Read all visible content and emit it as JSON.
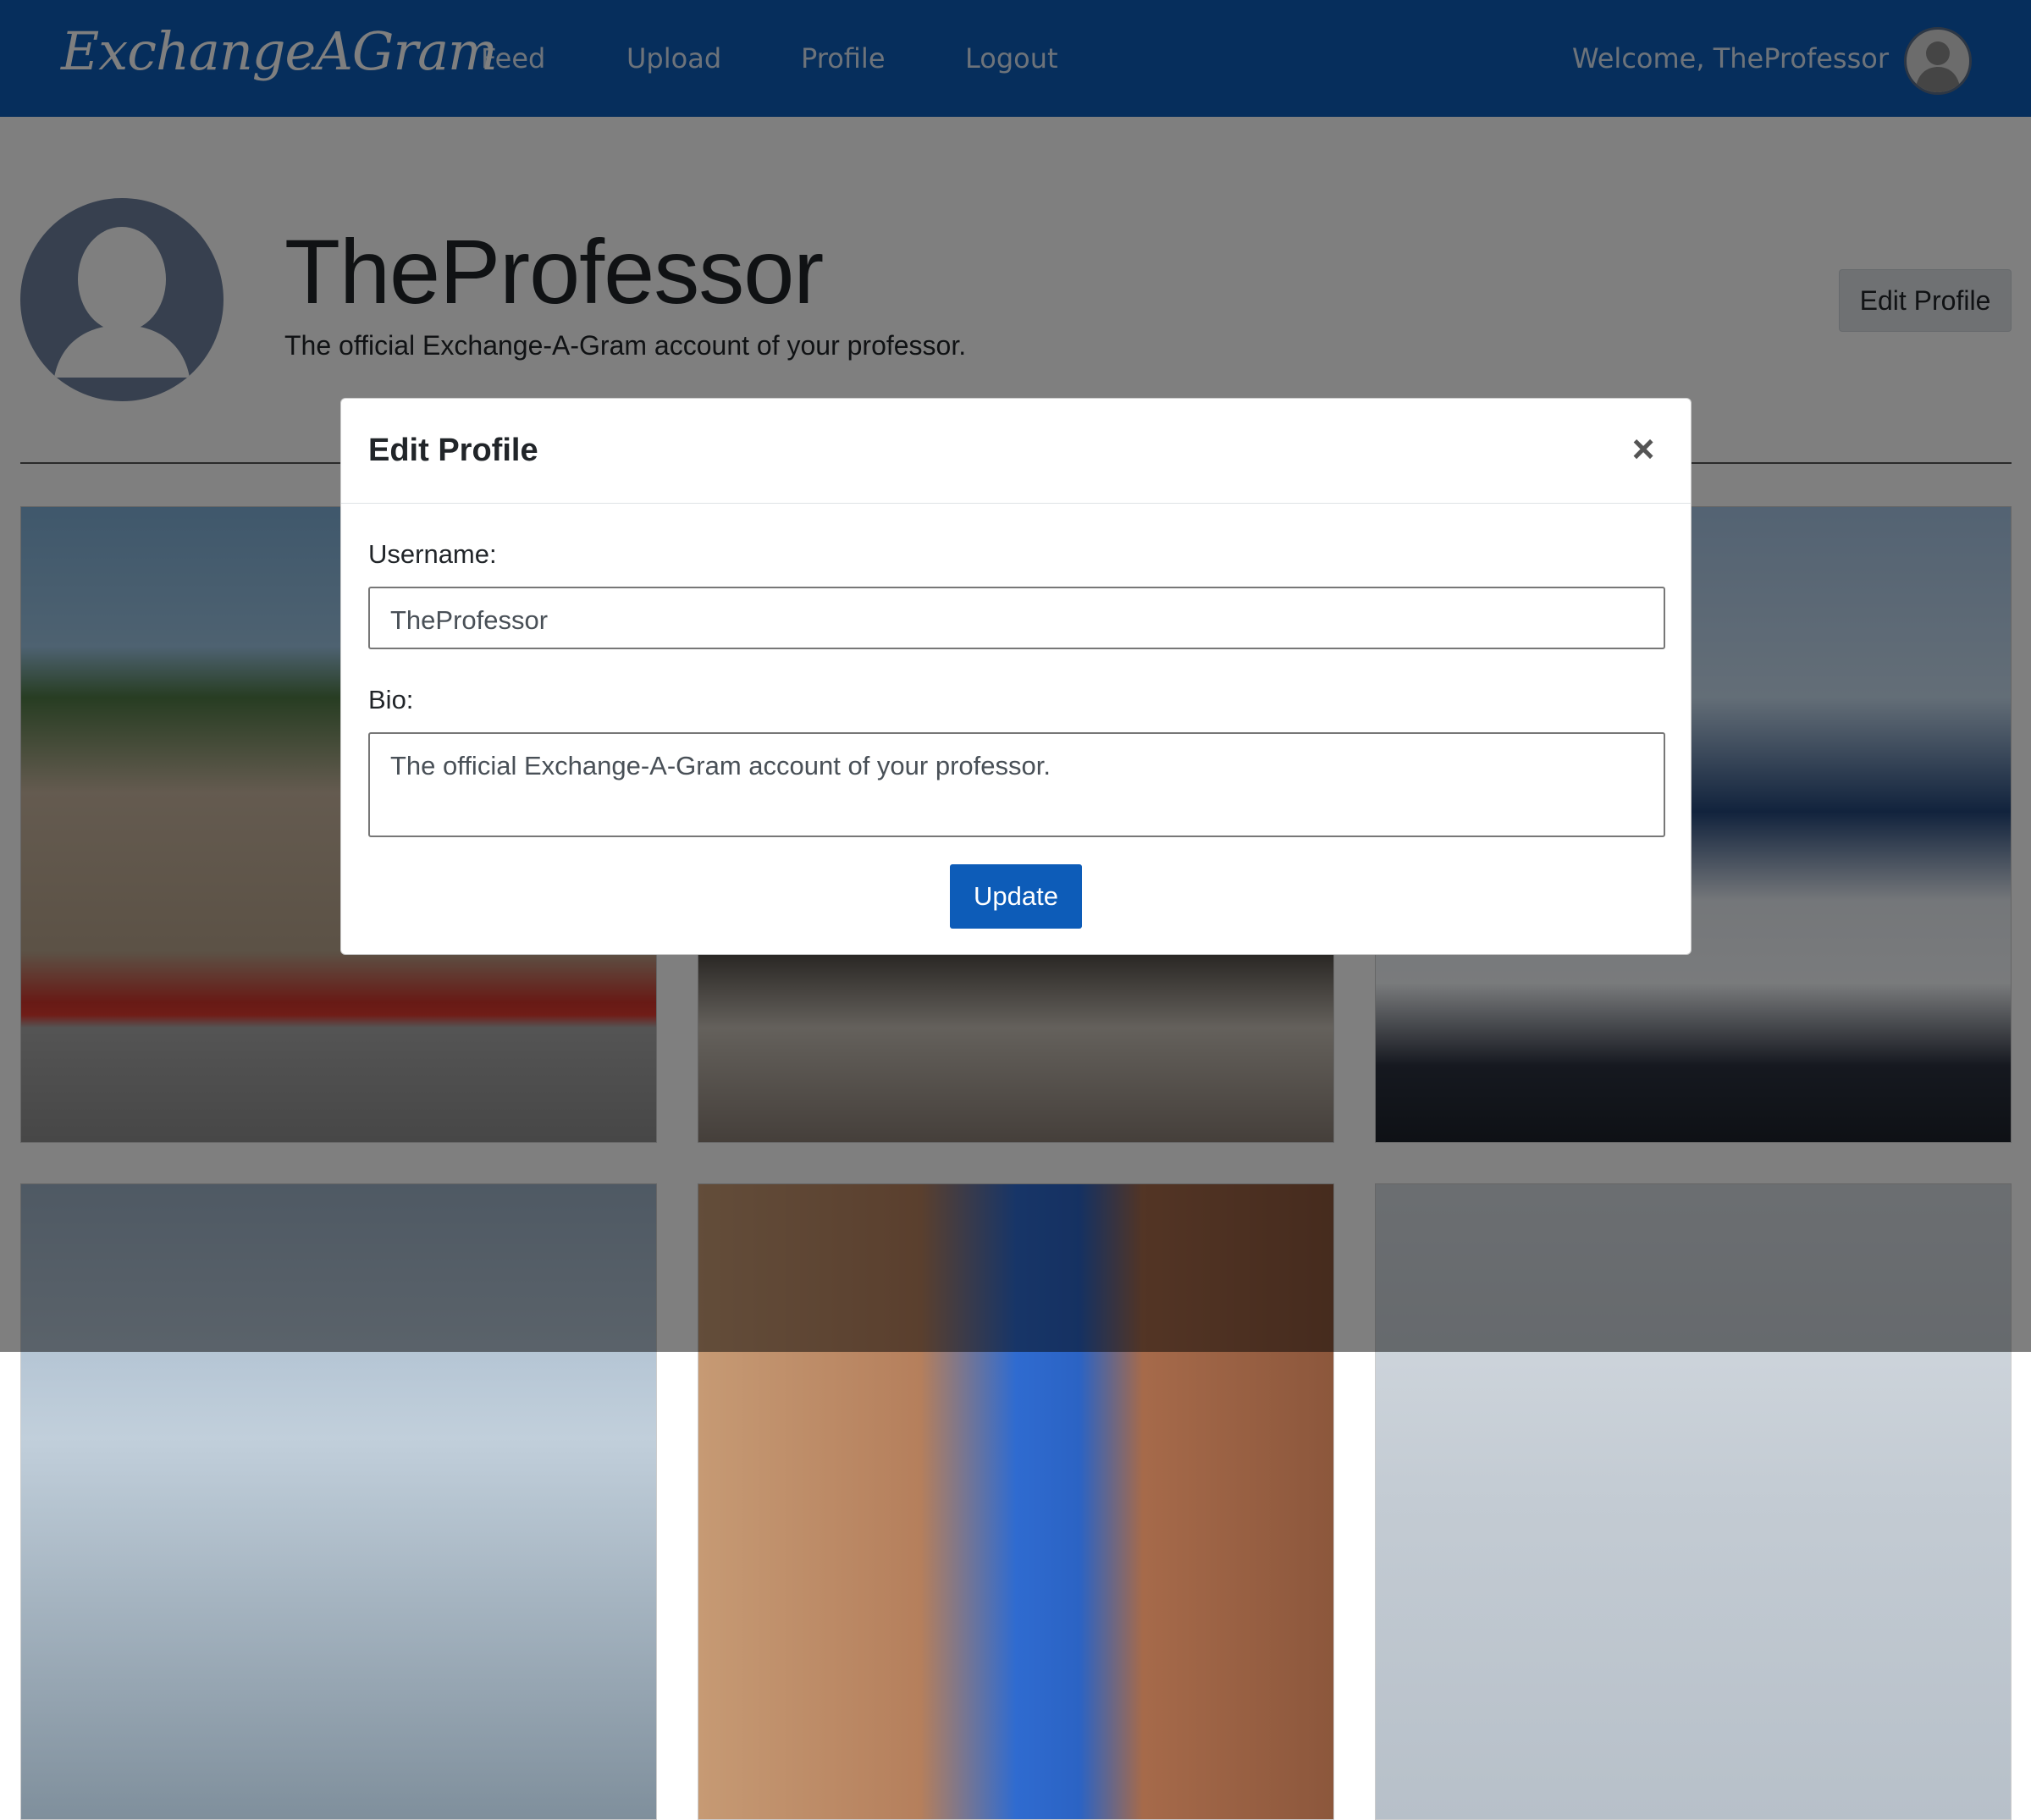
{
  "navbar": {
    "brand": "ExchangeAGram",
    "links": [
      "Feed",
      "Upload",
      "Profile",
      "Logout"
    ],
    "welcome": "Welcome, TheProfessor",
    "avatar_icon": "user-avatar-icon"
  },
  "profile": {
    "username": "TheProfessor",
    "bio": "The official Exchange-A-Gram account of your professor.",
    "edit_button": "Edit Profile"
  },
  "modal": {
    "title": "Edit Profile",
    "close_label": "×",
    "username_label": "Username:",
    "username_value": "TheProfessor",
    "bio_label": "Bio:",
    "bio_value": "The official Exchange-A-Gram account of your professor.",
    "submit_label": "Update"
  },
  "colors": {
    "brand": "#0d5cb8",
    "button_secondary": "#dee2e6",
    "backdrop": "rgba(0,0,0,0.5)"
  }
}
